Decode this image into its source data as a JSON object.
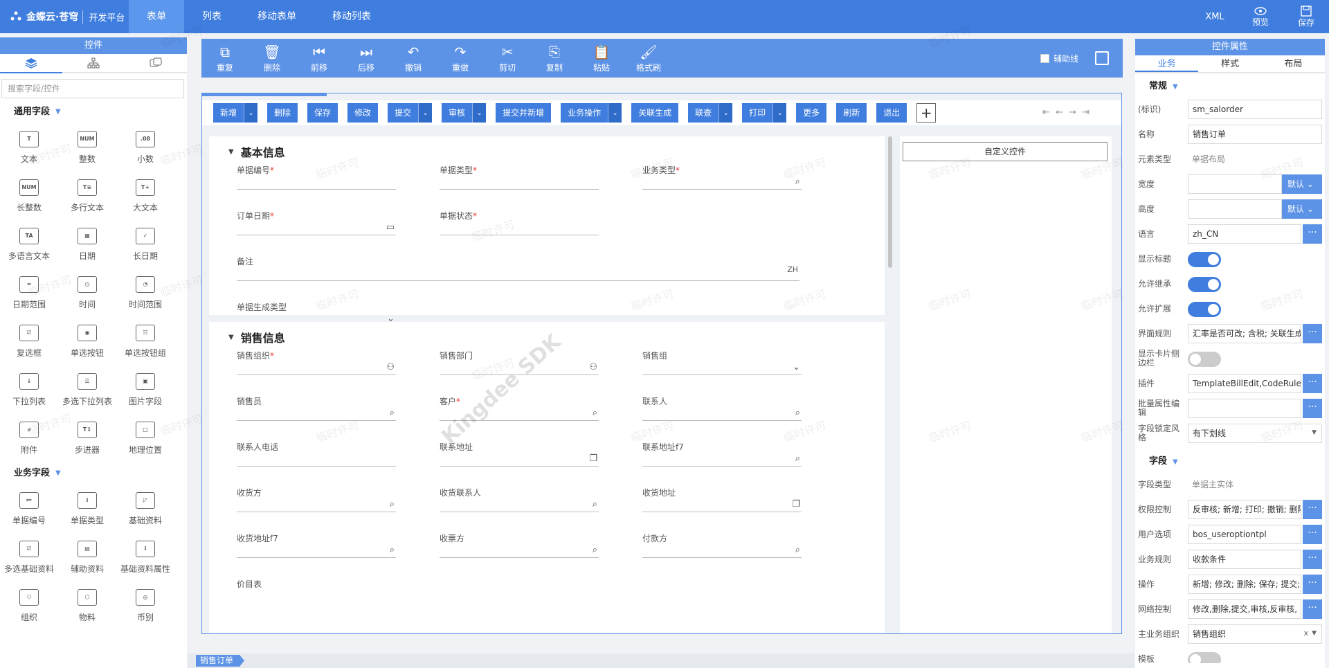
{
  "topbar": {
    "brand": "金蝶云·苍穹",
    "sub": "开发平台",
    "tabs": [
      "表单",
      "列表",
      "移动表单",
      "移动列表"
    ],
    "active_tab": "表单",
    "xml_label": "XML",
    "preview_label": "预览",
    "save_label": "保存"
  },
  "left_panel": {
    "title": "控件",
    "search_placeholder": "搜索字段/控件",
    "common_section": "通用字段",
    "common_items": [
      {
        "label": "文本",
        "icon": "text-icon"
      },
      {
        "label": "整数",
        "icon": "num-icon"
      },
      {
        "label": "小数",
        "icon": "decimal-icon"
      },
      {
        "label": "长整数",
        "icon": "long-num-icon"
      },
      {
        "label": "多行文本",
        "icon": "multiline-icon"
      },
      {
        "label": "大文本",
        "icon": "large-text-icon"
      },
      {
        "label": "多语言文本",
        "icon": "multilang-icon"
      },
      {
        "label": "日期",
        "icon": "date-icon"
      },
      {
        "label": "长日期",
        "icon": "long-date-icon"
      },
      {
        "label": "日期范围",
        "icon": "date-range-icon"
      },
      {
        "label": "时间",
        "icon": "time-icon"
      },
      {
        "label": "时间范围",
        "icon": "time-range-icon"
      },
      {
        "label": "复选框",
        "icon": "checkbox-icon"
      },
      {
        "label": "单选按钮",
        "icon": "radio-icon"
      },
      {
        "label": "单选按钮组",
        "icon": "radio-group-icon"
      },
      {
        "label": "下拉列表",
        "icon": "dropdown-icon"
      },
      {
        "label": "多选下拉列表",
        "icon": "multi-dropdown-icon"
      },
      {
        "label": "图片字段",
        "icon": "image-icon"
      },
      {
        "label": "附件",
        "icon": "attachment-icon"
      },
      {
        "label": "步进器",
        "icon": "stepper-icon"
      },
      {
        "label": "地理位置",
        "icon": "location-icon"
      }
    ],
    "business_section": "业务字段",
    "business_items": [
      {
        "label": "单据编号",
        "icon": "bill-number-icon"
      },
      {
        "label": "单据类型",
        "icon": "bill-type-icon"
      },
      {
        "label": "基础资料",
        "icon": "basedata-icon"
      },
      {
        "label": "多选基础资料",
        "icon": "multi-basedata-icon"
      },
      {
        "label": "辅助资料",
        "icon": "assist-data-icon"
      },
      {
        "label": "基础资料属性",
        "icon": "basedata-prop-icon"
      },
      {
        "label": "组织",
        "icon": "org-icon"
      },
      {
        "label": "物料",
        "icon": "material-icon"
      },
      {
        "label": "币别",
        "icon": "currency-icon"
      }
    ]
  },
  "toolbar": {
    "items": [
      "重复",
      "删除",
      "前移",
      "后移",
      "撤销",
      "重做",
      "剪切",
      "复制",
      "粘贴",
      "格式刷"
    ],
    "aux_label": "辅助线"
  },
  "form_buttons": [
    {
      "label": "新增",
      "dropdown": true
    },
    {
      "label": "删除",
      "dropdown": false
    },
    {
      "label": "保存",
      "dropdown": false
    },
    {
      "label": "修改",
      "dropdown": false
    },
    {
      "label": "提交",
      "dropdown": true
    },
    {
      "label": "审核",
      "dropdown": true
    },
    {
      "label": "提交并新增",
      "dropdown": false
    },
    {
      "label": "业务操作",
      "dropdown": true
    },
    {
      "label": "关联生成",
      "dropdown": false
    },
    {
      "label": "联查",
      "dropdown": true
    },
    {
      "label": "打印",
      "dropdown": true
    },
    {
      "label": "更多",
      "dropdown": false
    },
    {
      "label": "刷新",
      "dropdown": false
    },
    {
      "label": "退出",
      "dropdown": false
    }
  ],
  "basic_info": {
    "title": "基本信息",
    "bill_no": "单据编号",
    "bill_type": "单据类型",
    "biz_type": "业务类型",
    "order_date": "订单日期",
    "bill_status": "单据状态",
    "remark": "备注",
    "remark_suffix": "ZH",
    "gen_type": "单据生成类型"
  },
  "sales_info": {
    "title": "销售信息",
    "sale_org": "销售组织",
    "sale_dept": "销售部门",
    "sale_group": "销售组",
    "salesman": "销售员",
    "customer": "客户",
    "contact": "联系人",
    "contact_phone": "联系人电话",
    "contact_addr": "联系地址",
    "contact_addr_f7": "联系地址f7",
    "receiver": "收货方",
    "receiver_contact": "收货联系人",
    "receiver_addr": "收货地址",
    "receiver_addr_f7": "收货地址f7",
    "invoicee": "收票方",
    "payer": "付款方",
    "price_list": "价目表"
  },
  "custom_control": "自定义控件",
  "bottom_tab": "销售订单",
  "right_panel": {
    "title": "控件属性",
    "tabs": [
      "业务",
      "样式",
      "布局"
    ],
    "general_section": "常规",
    "field_section": "字段",
    "props": {
      "key_label": "(标识)",
      "key_value": "sm_salorder",
      "name_label": "名称",
      "name_value": "销售订单",
      "element_type_label": "元素类型",
      "element_type_value": "单据布局",
      "width_label": "宽度",
      "height_label": "高度",
      "default_label": "默认",
      "lang_label": "语言",
      "lang_value": "zh_CN",
      "show_title_label": "显示标题",
      "allow_inherit_label": "允许继承",
      "allow_extend_label": "允许扩展",
      "ui_rule_label": "界面规则",
      "ui_rule_value": "汇率是否可改; 含税; 关联生成",
      "show_card_label": "显示卡片侧边栏",
      "plugin_label": "插件",
      "plugin_value": "TemplateBillEdit,CodeRulePlugin",
      "batch_edit_label": "批量属性编辑",
      "batch_edit_value": "",
      "lock_style_label": "字段锁定风格",
      "lock_style_value": "有下划线",
      "field_type_label": "字段类型",
      "field_type_value": "单据主实体",
      "perm_label": "权限控制",
      "perm_value": "反审核; 新增; 打印; 撤销; 删除",
      "user_opt_label": "用户选项",
      "user_opt_value": "bos_useroptiontpl",
      "biz_rule_label": "业务规则",
      "biz_rule_value": "收款条件",
      "op_label": "操作",
      "op_value": "新增; 修改; 删除; 保存; 提交;",
      "net_label": "网络控制",
      "net_value": "修改,删除,提交,审核,反审核,",
      "main_org_label": "主业务组织",
      "main_org_value": "销售组织",
      "main_org_clear": "x",
      "template_label": "模板"
    }
  },
  "watermark": "临时许可",
  "watermark_big": "Kingdee SDK"
}
